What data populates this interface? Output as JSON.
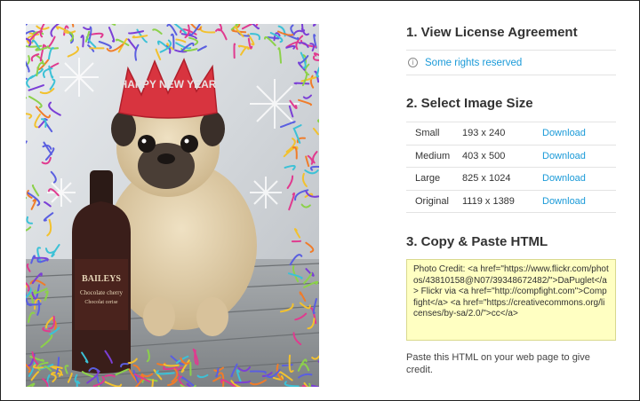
{
  "photo": {
    "description_icon": "party-pug-photo-icon",
    "hat_text": "HAPPY NEW YEAR",
    "bottle_brand": "BAILEYS",
    "bottle_sub": "Chocolate cherry",
    "bottle_sub2": "Chocolat cerise"
  },
  "license": {
    "heading": "1. View License Agreement",
    "info_icon": "i",
    "rights_text": "Some rights reserved"
  },
  "sizes": {
    "heading": "2. Select Image Size",
    "rows": [
      {
        "name": "Small",
        "dims": "193 x 240",
        "action": "Download"
      },
      {
        "name": "Medium",
        "dims": "403 x 500",
        "action": "Download"
      },
      {
        "name": "Large",
        "dims": "825 x 1024",
        "action": "Download"
      },
      {
        "name": "Original",
        "dims": "1119 x 1389",
        "action": "Download"
      }
    ]
  },
  "copy": {
    "heading": "3. Copy & Paste HTML",
    "html_snippet": "Photo Credit: <a href=\"https://www.flickr.com/photos/43810158@N07/39348672482/\">DaPuglet</a> Flickr via <a href=\"http://compfight.com\">Compfight</a> <a href=\"https://creativecommons.org/licenses/by-sa/2.0/\">cc</a>",
    "paste_note": "Paste this HTML on your web page to give credit."
  }
}
